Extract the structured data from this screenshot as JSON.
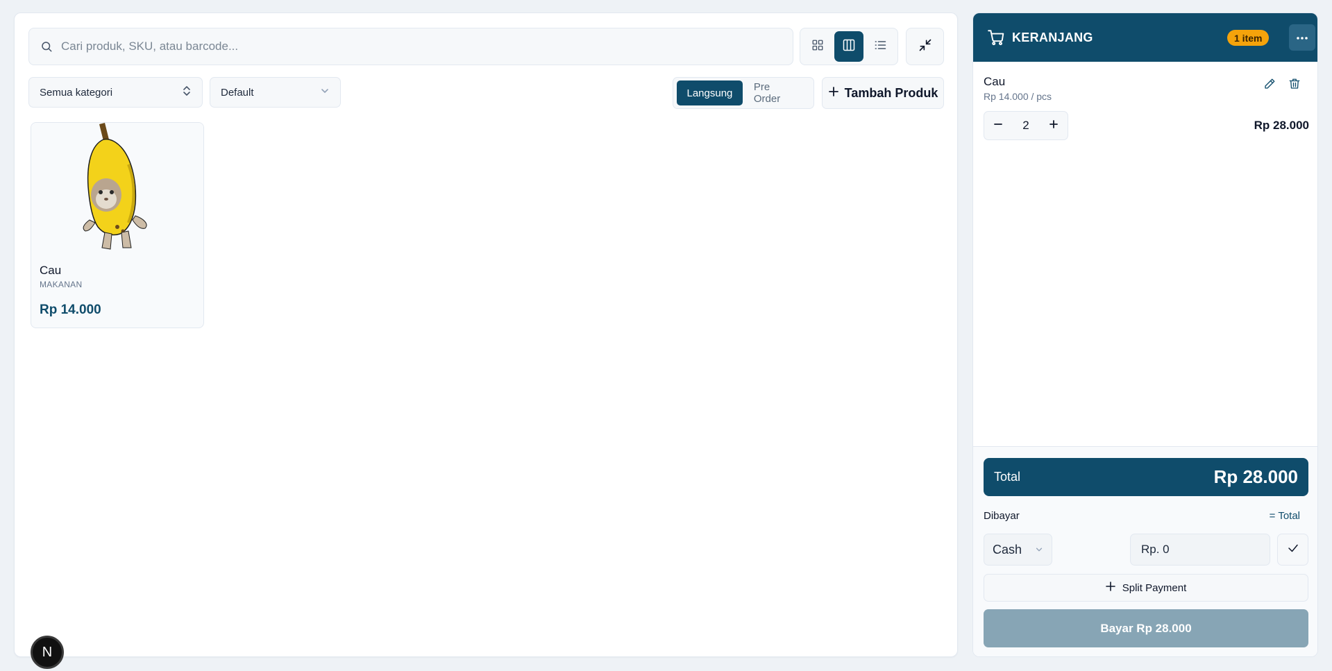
{
  "search": {
    "placeholder": "Cari produk, SKU, atau barcode..."
  },
  "view_modes": [
    {
      "name": "grid-small",
      "icon": "grid-icon",
      "active": false
    },
    {
      "name": "grid-large",
      "icon": "columns-icon",
      "active": true
    },
    {
      "name": "list",
      "icon": "list-icon",
      "active": false
    }
  ],
  "filters": {
    "category": "Semua kategori",
    "sort": "Default"
  },
  "sale_mode": {
    "options": [
      "Langsung",
      "Pre Order"
    ],
    "selected": "Langsung"
  },
  "add_product_label": "Tambah Produk",
  "products": [
    {
      "name": "Cau",
      "category": "MAKANAN",
      "price": "Rp 14.000"
    }
  ],
  "cart": {
    "title": "KERANJANG",
    "badge": "1 item",
    "items": [
      {
        "name": "Cau",
        "unit_price": "Rp 14.000 / pcs",
        "qty": "2",
        "line_total": "Rp 28.000"
      }
    ],
    "total_label": "Total",
    "total_value": "Rp 28.000",
    "paid_label": "Dibayar",
    "equal_total_label": "= Total",
    "payment_method": "Cash",
    "amount_placeholder": "Rp. 0",
    "split_payment_label": "Split Payment",
    "pay_button_label": "Bayar Rp 28.000"
  },
  "dev_badge": "N",
  "colors": {
    "primary": "#0f4c6b",
    "badge": "#f5a30b",
    "pay_disabled": "#87a5b5",
    "background": "#eef2f6"
  }
}
